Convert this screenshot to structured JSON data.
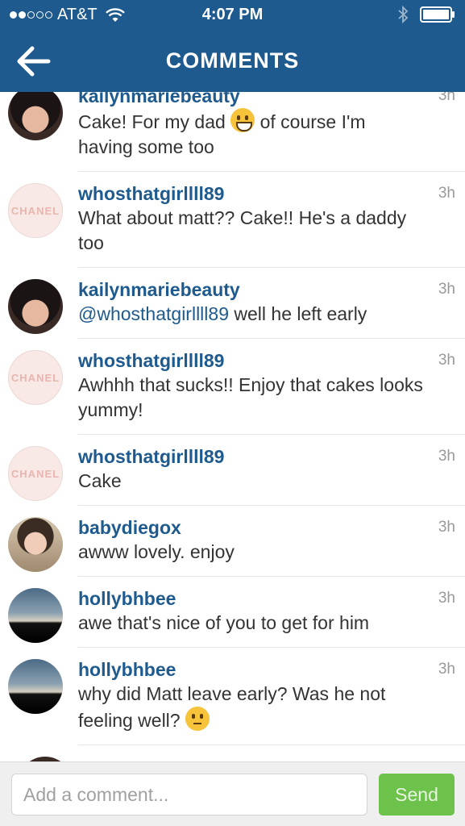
{
  "status_bar": {
    "carrier": "AT&T",
    "time": "4:07 PM",
    "signal_dots_filled": 2,
    "signal_dots_total": 5
  },
  "nav": {
    "title": "COMMENTS",
    "back_icon": "back-arrow-icon"
  },
  "comments": [
    {
      "user": "kailynmariebeauty",
      "time": "3h",
      "text_before": "Cake! For my dad ",
      "emoji": "grinning-face",
      "text_after": " of course I'm having some too",
      "avatar": "av-dark"
    },
    {
      "user": "whosthatgirllll89",
      "time": "3h",
      "text": "What about matt?? Cake!! He's a daddy too",
      "avatar": "av-chanel"
    },
    {
      "user": "kailynmariebeauty",
      "time": "3h",
      "mention": "@whosthatgirllll89",
      "text": " well he left early",
      "avatar": "av-dark"
    },
    {
      "user": "whosthatgirllll89",
      "time": "3h",
      "text": "Awhhh that sucks!! Enjoy that cakes looks yummy!",
      "avatar": "av-chanel"
    },
    {
      "user": "whosthatgirllll89",
      "time": "3h",
      "text": "Cake",
      "avatar": "av-chanel"
    },
    {
      "user": "babydiegox",
      "time": "3h",
      "text": "awww lovely. enjoy",
      "avatar": "av-baby"
    },
    {
      "user": "hollybhbee",
      "time": "3h",
      "text": "awe that's nice of you to get for him",
      "avatar": "av-holly"
    },
    {
      "user": "hollybhbee",
      "time": "3h",
      "text_before": "why did Matt leave early? Was he not feeling well? ",
      "emoji": "pensive-face",
      "text_after": "",
      "avatar": "av-holly"
    }
  ],
  "avatar_label": "CHANEL",
  "composer": {
    "placeholder": "Add a comment...",
    "send_label": "Send"
  },
  "colors": {
    "header": "#1e5a8e",
    "username": "#1e5a8e",
    "send_button": "#6cc24a"
  }
}
